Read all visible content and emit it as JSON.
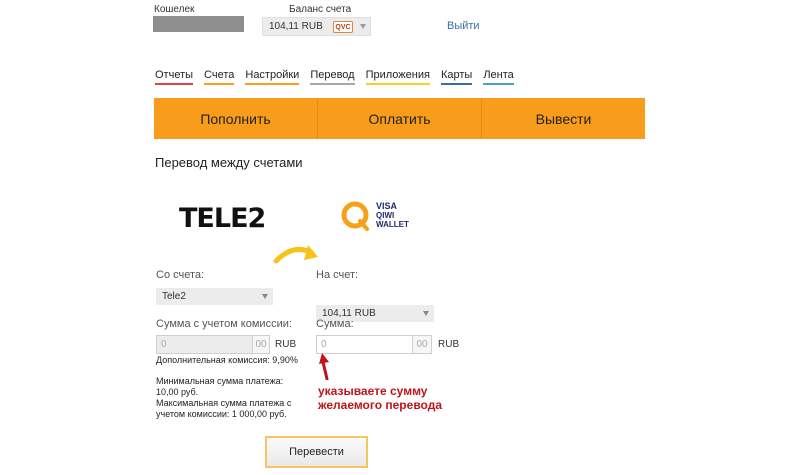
{
  "header": {
    "wallet_label": "Кошелек",
    "balance_label": "Баланс счета",
    "balance_value": "104,11 RUB",
    "balance_badge": "QVC",
    "logout_label": "Выйти"
  },
  "nav": {
    "items": [
      "Отчеты",
      "Счета",
      "Настройки",
      "Перевод",
      "Приложения",
      "Карты",
      "Лента"
    ]
  },
  "action_bar": {
    "topup_label": "Пополнить",
    "pay_label": "Оплатить",
    "withdraw_label": "Вывести",
    "color": "#f89c1c"
  },
  "transfer": {
    "title": "Перевод между счетами",
    "from_logo": "TELE2",
    "to_logo_lines": [
      "VISA",
      "QIWI",
      "WALLET"
    ],
    "from_label": "Со счета:",
    "from_value": "Tele2",
    "to_label": "На счет:",
    "to_value": "104,11 RUB",
    "sum_with_fee_label": "Сумма с учетом комиссии:",
    "sum_with_fee_value": "0",
    "sum_with_fee_cents": "00",
    "sum_label": "Сумма:",
    "sum_value": "0",
    "sum_cents": "00",
    "currency": "RUB",
    "extra_fee": "Дополнительная комиссия: 9,90%",
    "min_payment": "Минимальная сумма платежа: 10,00 руб.",
    "max_payment": "Максимальная сумма платежа с учетом комиссии: 1 000,00 руб.",
    "hint_line1": "указываете сумму",
    "hint_line2": "желаемого перевода",
    "submit_label": "Перевести"
  }
}
